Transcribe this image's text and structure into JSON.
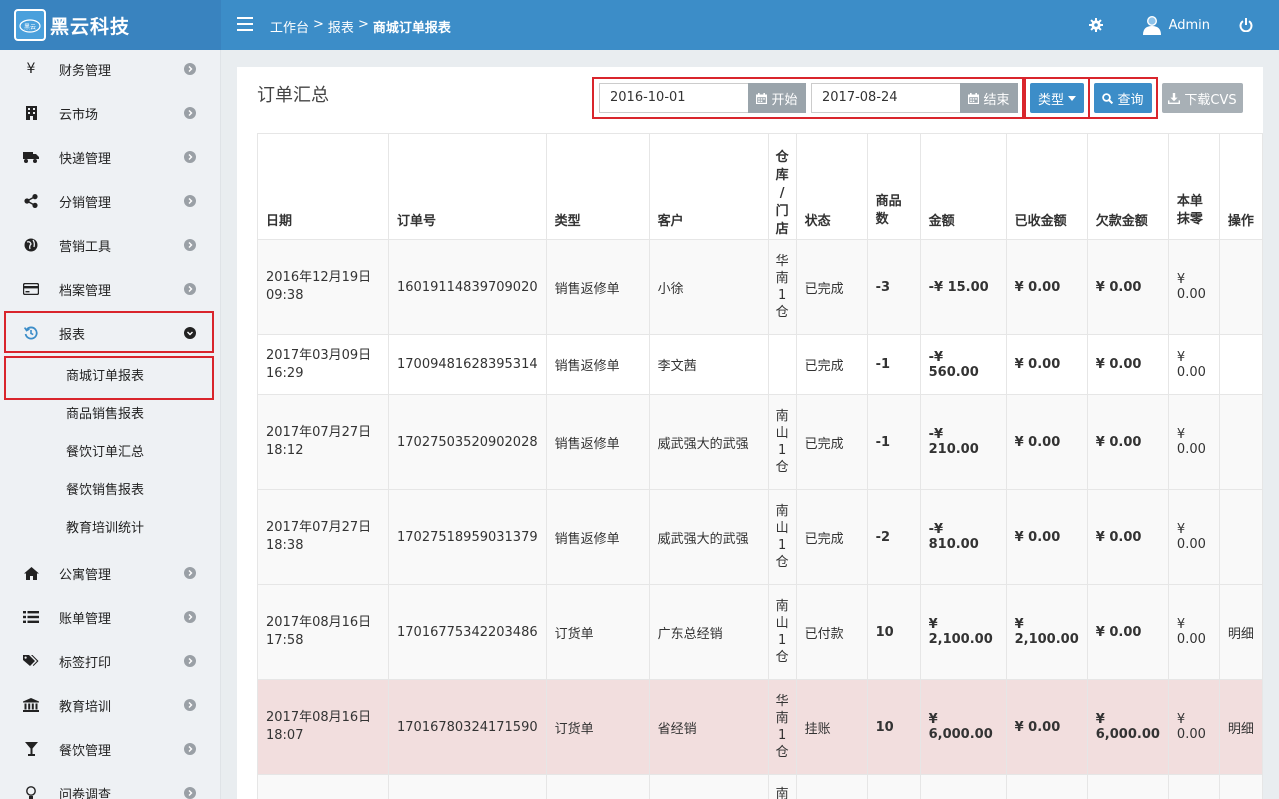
{
  "header": {
    "brand_logo_text": "黑云科技",
    "brand_name": "黑云科技",
    "breadcrumb": [
      {
        "label": "工作台"
      },
      {
        "label": "报表"
      },
      {
        "label": "商城订单报表"
      }
    ],
    "breadcrumb_sep": ">",
    "user_name": "Admin"
  },
  "sidebar": {
    "items": [
      {
        "label": "财务管理",
        "icon": "yen-icon"
      },
      {
        "label": "云市场",
        "icon": "building-icon"
      },
      {
        "label": "快递管理",
        "icon": "truck-icon"
      },
      {
        "label": "分销管理",
        "icon": "share-icon"
      },
      {
        "label": "营销工具",
        "icon": "globe-icon"
      },
      {
        "label": "档案管理",
        "icon": "credit-card-icon"
      },
      {
        "label": "报表",
        "icon": "history-icon"
      },
      {
        "label": "公寓管理",
        "icon": "home-icon"
      },
      {
        "label": "账单管理",
        "icon": "list-icon"
      },
      {
        "label": "标签打印",
        "icon": "tags-icon"
      },
      {
        "label": "教育培训",
        "icon": "bank-icon"
      },
      {
        "label": "餐饮管理",
        "icon": "glass-icon"
      },
      {
        "label": "问卷调查",
        "icon": "lightbulb-icon"
      }
    ],
    "sub_items": [
      {
        "label": "商城订单报表"
      },
      {
        "label": "商品销售报表"
      },
      {
        "label": "餐饮订单汇总"
      },
      {
        "label": "餐饮销售报表"
      },
      {
        "label": "教育培训统计"
      }
    ]
  },
  "main": {
    "title": "订单汇总",
    "start_date": "2016-10-01",
    "start_label": "开始",
    "end_date": "2017-08-24",
    "end_label": "结束",
    "type_label": "类型",
    "query_label": "查询",
    "download_label": "下载CVS"
  },
  "table": {
    "headers": [
      "日期",
      "订单号",
      "类型",
      "客户",
      "仓库/门店",
      "状态",
      "商品数",
      "金额",
      "已收金额",
      "欠款金额",
      "本单抹零",
      "操作"
    ],
    "header_display": {
      "store": [
        "仓",
        "库",
        "/",
        "门",
        "店"
      ],
      "qty": [
        "商品",
        "数"
      ],
      "zero": [
        "本单",
        "抹零"
      ]
    },
    "rows": [
      {
        "date1": "2016年12月19日",
        "date2": "09:38",
        "order": "16019114839709020",
        "type": "销售返修单",
        "customer": "小徐",
        "store": [
          "华",
          "南",
          "1",
          "仓"
        ],
        "status": "已完成",
        "qty": "-3",
        "amount": "-¥ 15.00",
        "received": "¥ 0.00",
        "owed": "¥ 0.00",
        "zero": "¥ 0.00",
        "action": ""
      },
      {
        "date1": "2017年03月09日",
        "date2": "16:29",
        "order": "17009481628395314",
        "type": "销售返修单",
        "customer": "李文茜",
        "store": [],
        "status": "已完成",
        "qty": "-1",
        "amount": "-¥ 560.00",
        "received": "¥ 0.00",
        "owed": "¥ 0.00",
        "zero": "¥ 0.00",
        "action": ""
      },
      {
        "date1": "2017年07月27日",
        "date2": "18:12",
        "order": "17027503520902028",
        "type": "销售返修单",
        "customer": "威武强大的武强",
        "store": [
          "南",
          "山",
          "1",
          "仓"
        ],
        "status": "已完成",
        "qty": "-1",
        "amount": "-¥ 210.00",
        "received": "¥ 0.00",
        "owed": "¥ 0.00",
        "zero": "¥ 0.00",
        "action": ""
      },
      {
        "date1": "2017年07月27日",
        "date2": "18:38",
        "order": "17027518959031379",
        "type": "销售返修单",
        "customer": "威武强大的武强",
        "store": [
          "南",
          "山",
          "1",
          "仓"
        ],
        "status": "已完成",
        "qty": "-2",
        "amount": "-¥ 810.00",
        "received": "¥ 0.00",
        "owed": "¥ 0.00",
        "zero": "¥ 0.00",
        "action": ""
      },
      {
        "date1": "2017年08月16日",
        "date2": "17:58",
        "order": "17016775342203486",
        "type": "订货单",
        "customer": "广东总经销",
        "store": [
          "南",
          "山",
          "1",
          "仓"
        ],
        "status": "已付款",
        "qty": "10",
        "amount": "¥ 2,100.00",
        "received": "¥ 2,100.00",
        "owed": "¥ 0.00",
        "zero": "¥ 0.00",
        "action": "明细"
      },
      {
        "date1": "2017年08月16日",
        "date2": "18:07",
        "order": "17016780324171590",
        "type": "订货单",
        "customer": "省经销",
        "store": [
          "华",
          "南",
          "1",
          "仓"
        ],
        "status": "挂账",
        "qty": "10",
        "amount": "¥ 6,000.00",
        "received": "¥ 0.00",
        "owed": "¥ 6,000.00",
        "zero": "¥ 0.00",
        "action": "明细"
      },
      {
        "date1": "",
        "date2": "",
        "order": "",
        "type": "",
        "customer": "",
        "store": [
          "南"
        ],
        "status": "",
        "qty": "",
        "amount": "",
        "received": "",
        "owed": "",
        "zero": "",
        "action": ""
      }
    ]
  },
  "colors": {
    "header_blue": "#3c8dc8",
    "brand_blue": "#3983bf",
    "highlight_red": "#d9252c",
    "row_danger_bg": "#f2dede"
  }
}
